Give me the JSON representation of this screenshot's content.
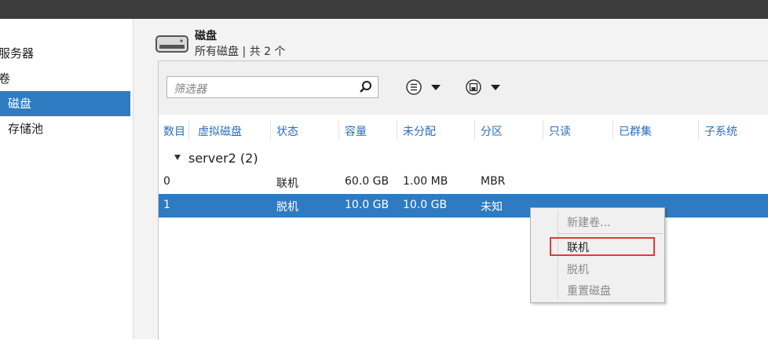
{
  "sidebar": {
    "items": [
      {
        "label": "服务器"
      },
      {
        "label": "卷"
      },
      {
        "label": "磁盘"
      },
      {
        "label": "存储池"
      }
    ]
  },
  "tile": {
    "title": "磁盘",
    "subtitle": "所有磁盘 | 共 2 个"
  },
  "toolbar": {
    "filter_placeholder": "筛选器"
  },
  "table": {
    "columns": [
      "数目",
      "虚拟磁盘",
      "状态",
      "容量",
      "未分配",
      "分区",
      "只读",
      "已群集",
      "子系统"
    ],
    "group_label": "server2 (2)",
    "rows": [
      {
        "num": "0",
        "status": "联机",
        "capacity": "60.0 GB",
        "unallocated": "1.00 MB",
        "partition": "MBR",
        "selected": false
      },
      {
        "num": "1",
        "status": "脱机",
        "capacity": "10.0 GB",
        "unallocated": "10.0 GB",
        "partition": "未知",
        "selected": true
      }
    ]
  },
  "context_menu": {
    "items": [
      {
        "label": "新建卷...",
        "enabled": false
      },
      {
        "label": "联机",
        "enabled": true
      },
      {
        "label": "脱机",
        "enabled": false
      },
      {
        "label": "重置磁盘",
        "enabled": false
      }
    ]
  },
  "colors": {
    "selection": "#2f7bc1",
    "header_text": "#2a6ebb",
    "highlight_box": "#e0393b"
  }
}
